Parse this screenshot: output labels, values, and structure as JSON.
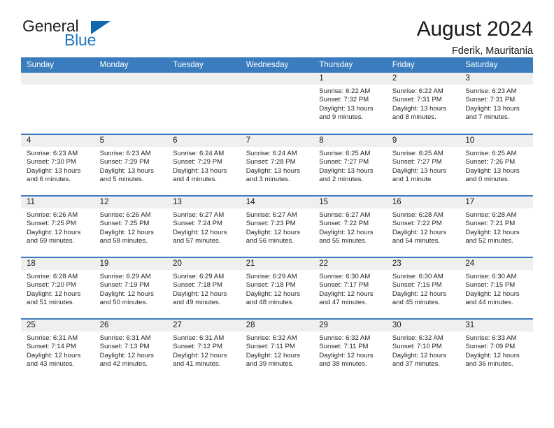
{
  "brand": {
    "word_general": "General",
    "word_blue": "Blue",
    "triangle_color": "#1068b0",
    "blue_color": "#1f77bd"
  },
  "header": {
    "title": "August 2024",
    "subtitle": "Fderik, Mauritania"
  },
  "theme": {
    "header_bg": "#3a7cbe",
    "daynum_bg": "#efefef",
    "row_divider": "#3a7cbe"
  },
  "weekday_headers": [
    "Sunday",
    "Monday",
    "Tuesday",
    "Wednesday",
    "Thursday",
    "Friday",
    "Saturday"
  ],
  "weeks": [
    [
      {
        "day": "",
        "sunrise": "",
        "sunset": "",
        "daylight1": "",
        "daylight2": ""
      },
      {
        "day": "",
        "sunrise": "",
        "sunset": "",
        "daylight1": "",
        "daylight2": ""
      },
      {
        "day": "",
        "sunrise": "",
        "sunset": "",
        "daylight1": "",
        "daylight2": ""
      },
      {
        "day": "",
        "sunrise": "",
        "sunset": "",
        "daylight1": "",
        "daylight2": ""
      },
      {
        "day": "1",
        "sunrise": "Sunrise: 6:22 AM",
        "sunset": "Sunset: 7:32 PM",
        "daylight1": "Daylight: 13 hours",
        "daylight2": "and 9 minutes."
      },
      {
        "day": "2",
        "sunrise": "Sunrise: 6:22 AM",
        "sunset": "Sunset: 7:31 PM",
        "daylight1": "Daylight: 13 hours",
        "daylight2": "and 8 minutes."
      },
      {
        "day": "3",
        "sunrise": "Sunrise: 6:23 AM",
        "sunset": "Sunset: 7:31 PM",
        "daylight1": "Daylight: 13 hours",
        "daylight2": "and 7 minutes."
      }
    ],
    [
      {
        "day": "4",
        "sunrise": "Sunrise: 6:23 AM",
        "sunset": "Sunset: 7:30 PM",
        "daylight1": "Daylight: 13 hours",
        "daylight2": "and 6 minutes."
      },
      {
        "day": "5",
        "sunrise": "Sunrise: 6:23 AM",
        "sunset": "Sunset: 7:29 PM",
        "daylight1": "Daylight: 13 hours",
        "daylight2": "and 5 minutes."
      },
      {
        "day": "6",
        "sunrise": "Sunrise: 6:24 AM",
        "sunset": "Sunset: 7:29 PM",
        "daylight1": "Daylight: 13 hours",
        "daylight2": "and 4 minutes."
      },
      {
        "day": "7",
        "sunrise": "Sunrise: 6:24 AM",
        "sunset": "Sunset: 7:28 PM",
        "daylight1": "Daylight: 13 hours",
        "daylight2": "and 3 minutes."
      },
      {
        "day": "8",
        "sunrise": "Sunrise: 6:25 AM",
        "sunset": "Sunset: 7:27 PM",
        "daylight1": "Daylight: 13 hours",
        "daylight2": "and 2 minutes."
      },
      {
        "day": "9",
        "sunrise": "Sunrise: 6:25 AM",
        "sunset": "Sunset: 7:27 PM",
        "daylight1": "Daylight: 13 hours",
        "daylight2": "and 1 minute."
      },
      {
        "day": "10",
        "sunrise": "Sunrise: 6:25 AM",
        "sunset": "Sunset: 7:26 PM",
        "daylight1": "Daylight: 13 hours",
        "daylight2": "and 0 minutes."
      }
    ],
    [
      {
        "day": "11",
        "sunrise": "Sunrise: 6:26 AM",
        "sunset": "Sunset: 7:25 PM",
        "daylight1": "Daylight: 12 hours",
        "daylight2": "and 59 minutes."
      },
      {
        "day": "12",
        "sunrise": "Sunrise: 6:26 AM",
        "sunset": "Sunset: 7:25 PM",
        "daylight1": "Daylight: 12 hours",
        "daylight2": "and 58 minutes."
      },
      {
        "day": "13",
        "sunrise": "Sunrise: 6:27 AM",
        "sunset": "Sunset: 7:24 PM",
        "daylight1": "Daylight: 12 hours",
        "daylight2": "and 57 minutes."
      },
      {
        "day": "14",
        "sunrise": "Sunrise: 6:27 AM",
        "sunset": "Sunset: 7:23 PM",
        "daylight1": "Daylight: 12 hours",
        "daylight2": "and 56 minutes."
      },
      {
        "day": "15",
        "sunrise": "Sunrise: 6:27 AM",
        "sunset": "Sunset: 7:22 PM",
        "daylight1": "Daylight: 12 hours",
        "daylight2": "and 55 minutes."
      },
      {
        "day": "16",
        "sunrise": "Sunrise: 6:28 AM",
        "sunset": "Sunset: 7:22 PM",
        "daylight1": "Daylight: 12 hours",
        "daylight2": "and 54 minutes."
      },
      {
        "day": "17",
        "sunrise": "Sunrise: 6:28 AM",
        "sunset": "Sunset: 7:21 PM",
        "daylight1": "Daylight: 12 hours",
        "daylight2": "and 52 minutes."
      }
    ],
    [
      {
        "day": "18",
        "sunrise": "Sunrise: 6:28 AM",
        "sunset": "Sunset: 7:20 PM",
        "daylight1": "Daylight: 12 hours",
        "daylight2": "and 51 minutes."
      },
      {
        "day": "19",
        "sunrise": "Sunrise: 6:29 AM",
        "sunset": "Sunset: 7:19 PM",
        "daylight1": "Daylight: 12 hours",
        "daylight2": "and 50 minutes."
      },
      {
        "day": "20",
        "sunrise": "Sunrise: 6:29 AM",
        "sunset": "Sunset: 7:18 PM",
        "daylight1": "Daylight: 12 hours",
        "daylight2": "and 49 minutes."
      },
      {
        "day": "21",
        "sunrise": "Sunrise: 6:29 AM",
        "sunset": "Sunset: 7:18 PM",
        "daylight1": "Daylight: 12 hours",
        "daylight2": "and 48 minutes."
      },
      {
        "day": "22",
        "sunrise": "Sunrise: 6:30 AM",
        "sunset": "Sunset: 7:17 PM",
        "daylight1": "Daylight: 12 hours",
        "daylight2": "and 47 minutes."
      },
      {
        "day": "23",
        "sunrise": "Sunrise: 6:30 AM",
        "sunset": "Sunset: 7:16 PM",
        "daylight1": "Daylight: 12 hours",
        "daylight2": "and 45 minutes."
      },
      {
        "day": "24",
        "sunrise": "Sunrise: 6:30 AM",
        "sunset": "Sunset: 7:15 PM",
        "daylight1": "Daylight: 12 hours",
        "daylight2": "and 44 minutes."
      }
    ],
    [
      {
        "day": "25",
        "sunrise": "Sunrise: 6:31 AM",
        "sunset": "Sunset: 7:14 PM",
        "daylight1": "Daylight: 12 hours",
        "daylight2": "and 43 minutes."
      },
      {
        "day": "26",
        "sunrise": "Sunrise: 6:31 AM",
        "sunset": "Sunset: 7:13 PM",
        "daylight1": "Daylight: 12 hours",
        "daylight2": "and 42 minutes."
      },
      {
        "day": "27",
        "sunrise": "Sunrise: 6:31 AM",
        "sunset": "Sunset: 7:12 PM",
        "daylight1": "Daylight: 12 hours",
        "daylight2": "and 41 minutes."
      },
      {
        "day": "28",
        "sunrise": "Sunrise: 6:32 AM",
        "sunset": "Sunset: 7:11 PM",
        "daylight1": "Daylight: 12 hours",
        "daylight2": "and 39 minutes."
      },
      {
        "day": "29",
        "sunrise": "Sunrise: 6:32 AM",
        "sunset": "Sunset: 7:11 PM",
        "daylight1": "Daylight: 12 hours",
        "daylight2": "and 38 minutes."
      },
      {
        "day": "30",
        "sunrise": "Sunrise: 6:32 AM",
        "sunset": "Sunset: 7:10 PM",
        "daylight1": "Daylight: 12 hours",
        "daylight2": "and 37 minutes."
      },
      {
        "day": "31",
        "sunrise": "Sunrise: 6:33 AM",
        "sunset": "Sunset: 7:09 PM",
        "daylight1": "Daylight: 12 hours",
        "daylight2": "and 36 minutes."
      }
    ]
  ]
}
